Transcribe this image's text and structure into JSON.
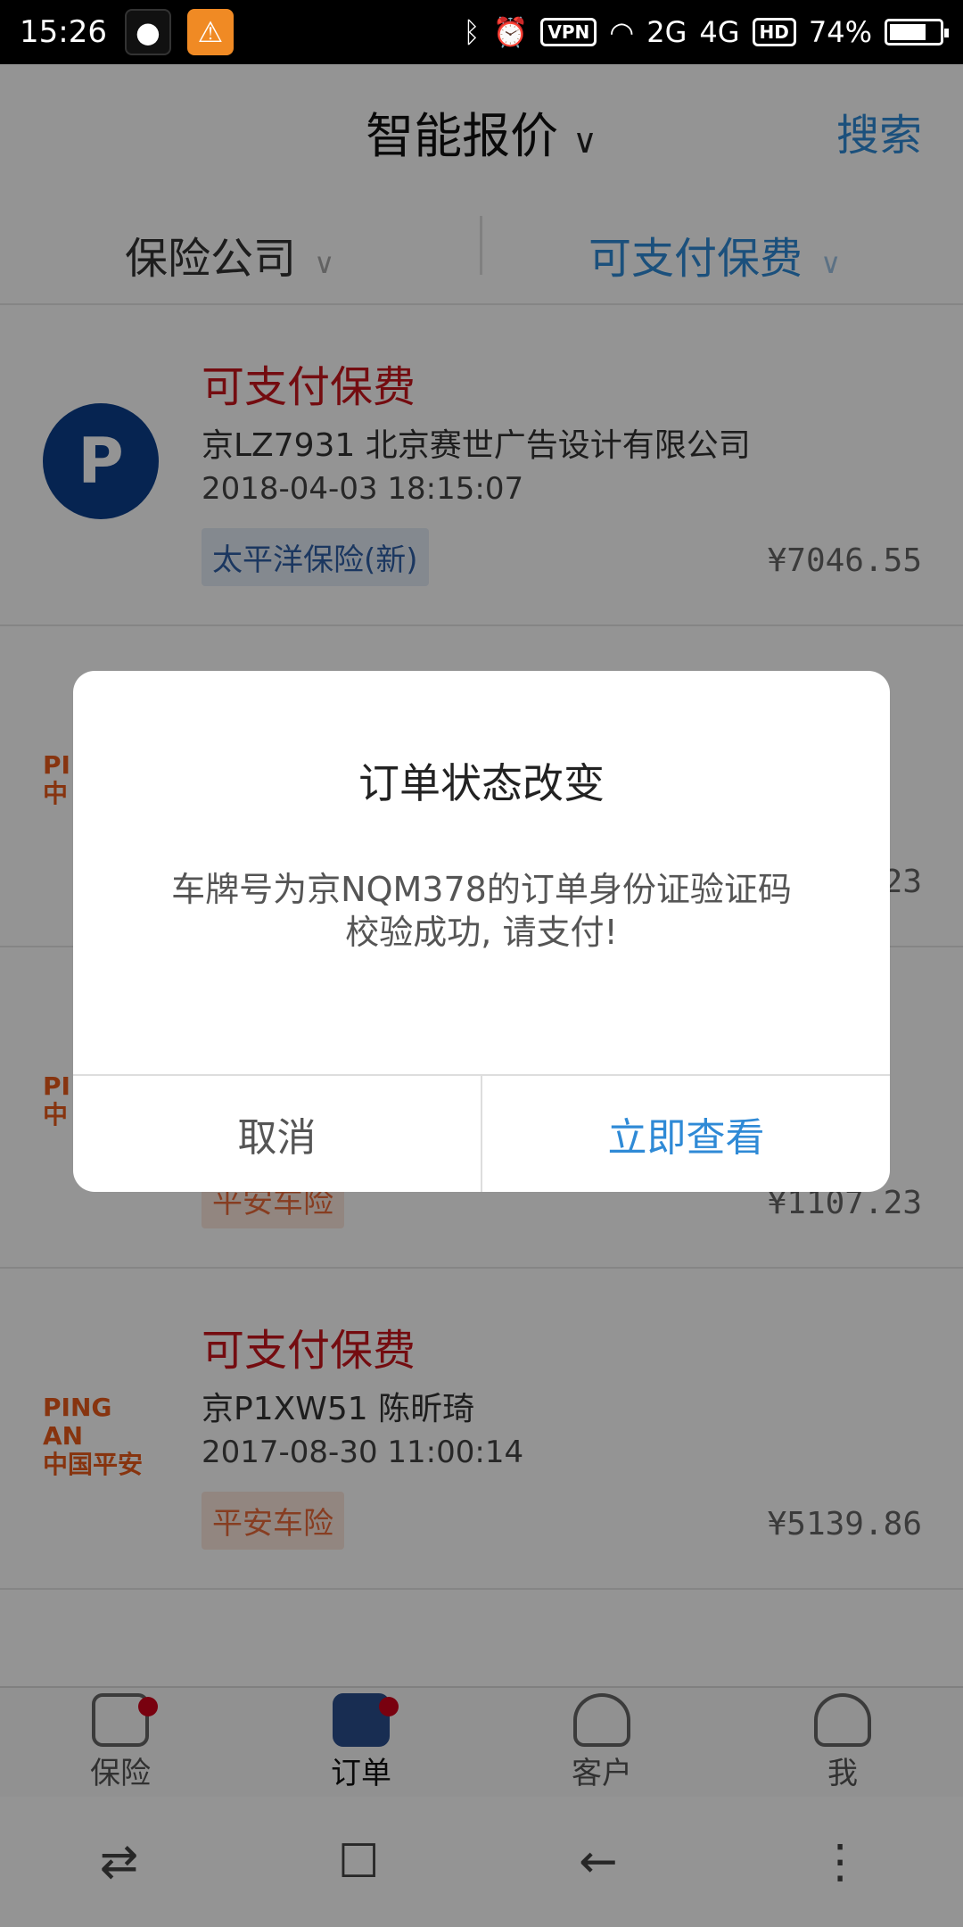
{
  "statusbar": {
    "time": "15:26",
    "network_2g": "2G",
    "network_4g": "4G",
    "hd_label": "HD",
    "vpn_label": "VPN",
    "battery": "74%",
    "battery_level": 0.74
  },
  "header": {
    "title": "智能报价",
    "search_label": "搜索"
  },
  "filters": {
    "company": "保险公司",
    "status": "可支付保费"
  },
  "orders": [
    {
      "status": "可支付保费",
      "plate_and_name": "京LZ7931 北京赛世广告设计有限公司",
      "datetime": "2018-04-03 18:15:07",
      "insurer_tag": "太平洋保险(新)",
      "price": "¥7046.55",
      "logo": "cpic-logo-icon"
    },
    {
      "status": "",
      "plate_and_name": "",
      "datetime": "",
      "insurer_tag": "",
      "price": "",
      "logo": "pingan-logo-icon",
      "logo_text_1": "PI",
      "logo_text_2": "中",
      "price_partial": "23"
    },
    {
      "status": "",
      "plate_and_name": "",
      "datetime": "",
      "insurer_tag": "平安车险",
      "price": "¥1107.23",
      "logo": "pingan-logo-icon",
      "logo_text_1": "PI",
      "logo_text_2": "中"
    },
    {
      "status": "可支付保费",
      "plate_and_name": "京P1XW51 陈昕琦",
      "datetime": "2017-08-30 11:00:14",
      "insurer_tag": "平安车险",
      "price": "¥5139.86",
      "logo": "pingan-logo-icon",
      "logo_text_1": "PING AN",
      "logo_text_2": "中国平安"
    }
  ],
  "bottom_nav": {
    "items": [
      {
        "label": "保险",
        "icon": "car-icon",
        "badge": true
      },
      {
        "label": "订单",
        "icon": "document-icon",
        "badge": true,
        "active": true
      },
      {
        "label": "客户",
        "icon": "person-icon",
        "badge": false
      },
      {
        "label": "我",
        "icon": "person-icon",
        "badge": false
      }
    ]
  },
  "system_nav": {
    "switch": "⇄",
    "home": "☐",
    "back": "←",
    "menu": "⋮"
  },
  "dialog": {
    "title": "订单状态改变",
    "message_line1": "车牌号为京NQM378的订单身份证验证码",
    "message_line2": "校验成功, 请支付!",
    "cancel_label": "取消",
    "confirm_label": "立即查看"
  },
  "colors": {
    "accent_blue": "#2f8ad6",
    "status_red": "#c8161d",
    "pingan_orange": "#e85a1b",
    "cpic_blue": "#0b3f8c",
    "badge_red": "#d0021b"
  }
}
